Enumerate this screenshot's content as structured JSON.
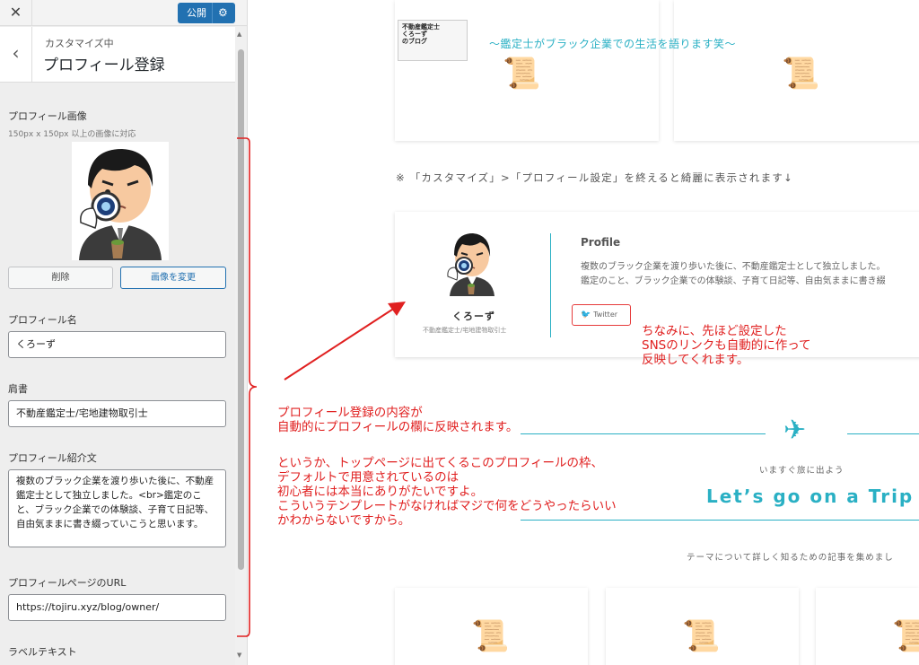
{
  "topbar": {
    "close_label": "✕",
    "publish_label": "公開",
    "gear_glyph": "⚙"
  },
  "section": {
    "back_glyph": "‹",
    "subtitle": "カスタマイズ中",
    "title": "プロフィール登録"
  },
  "fields": {
    "image_label": "プロフィール画像",
    "image_note": "150px x 150px 以上の画像に対応",
    "remove_label": "削除",
    "change_label": "画像を変更",
    "name_label": "プロフィール名",
    "name_value": "くろーず",
    "role_label": "肩書",
    "role_value": "不動産鑑定士/宅地建物取引士",
    "intro_label": "プロフィール紹介文",
    "intro_value": "複数のブラック企業を渡り歩いた後に、不動産鑑定士として独立しました。<br>鑑定のこと、ブラック企業での体験談、子育て日記等、自由気ままに書き綴っていこうと思います。",
    "url_label": "プロフィールページのURL",
    "url_value": "https://tojiru.xyz/blog/owner/",
    "label_text_label": "ラベルテキスト"
  },
  "preview": {
    "blog_logo_text": "不動産鑑定士\nくろーず\nのブログ",
    "blog_tagline": "～鑑定士がブラック企業での生活を語ります笑～",
    "notice": "※ 「カスタマイズ」>「プロフィール設定」を終えると綺麗に表示されます↓",
    "profile": {
      "name": "くろーず",
      "role": "不動産鑑定士/宅地建物取引士",
      "heading": "Profile",
      "intro_line1": "複数のブラック企業を渡り歩いた後に、不動産鑑定士として独立しました。",
      "intro_line2": "鑑定のこと、ブラック企業での体験談、子育て日記等、自由気ままに書き綴",
      "twitter_label": "Twitter"
    },
    "trip_sub": "いますぐ旅に出よう",
    "trip_title": "Let’s go on a Trip",
    "trip_desc": "テーマについて詳しく知るための記事を集めまし"
  },
  "annotations": {
    "sns_note": [
      "ちなみに、先ほど設定した",
      "SNSのリンクも自動的に作って",
      "反映してくれます。"
    ],
    "reflect_note": [
      "プロフィール登録の内容が",
      "自動的にプロフィールの欄に反映されます。"
    ],
    "template_note": [
      "というか、トップページに出てくるこのプロフィールの枠、",
      "デフォルトで用意されているのは",
      "初心者には本当にありがたいですよ。",
      "こういうテンプレートがなければマジで何をどうやったらいい",
      "かわからないですから。"
    ]
  },
  "colors": {
    "accent": "#2ab0c4",
    "annotation": "#e02020",
    "publish": "#2271b1"
  }
}
